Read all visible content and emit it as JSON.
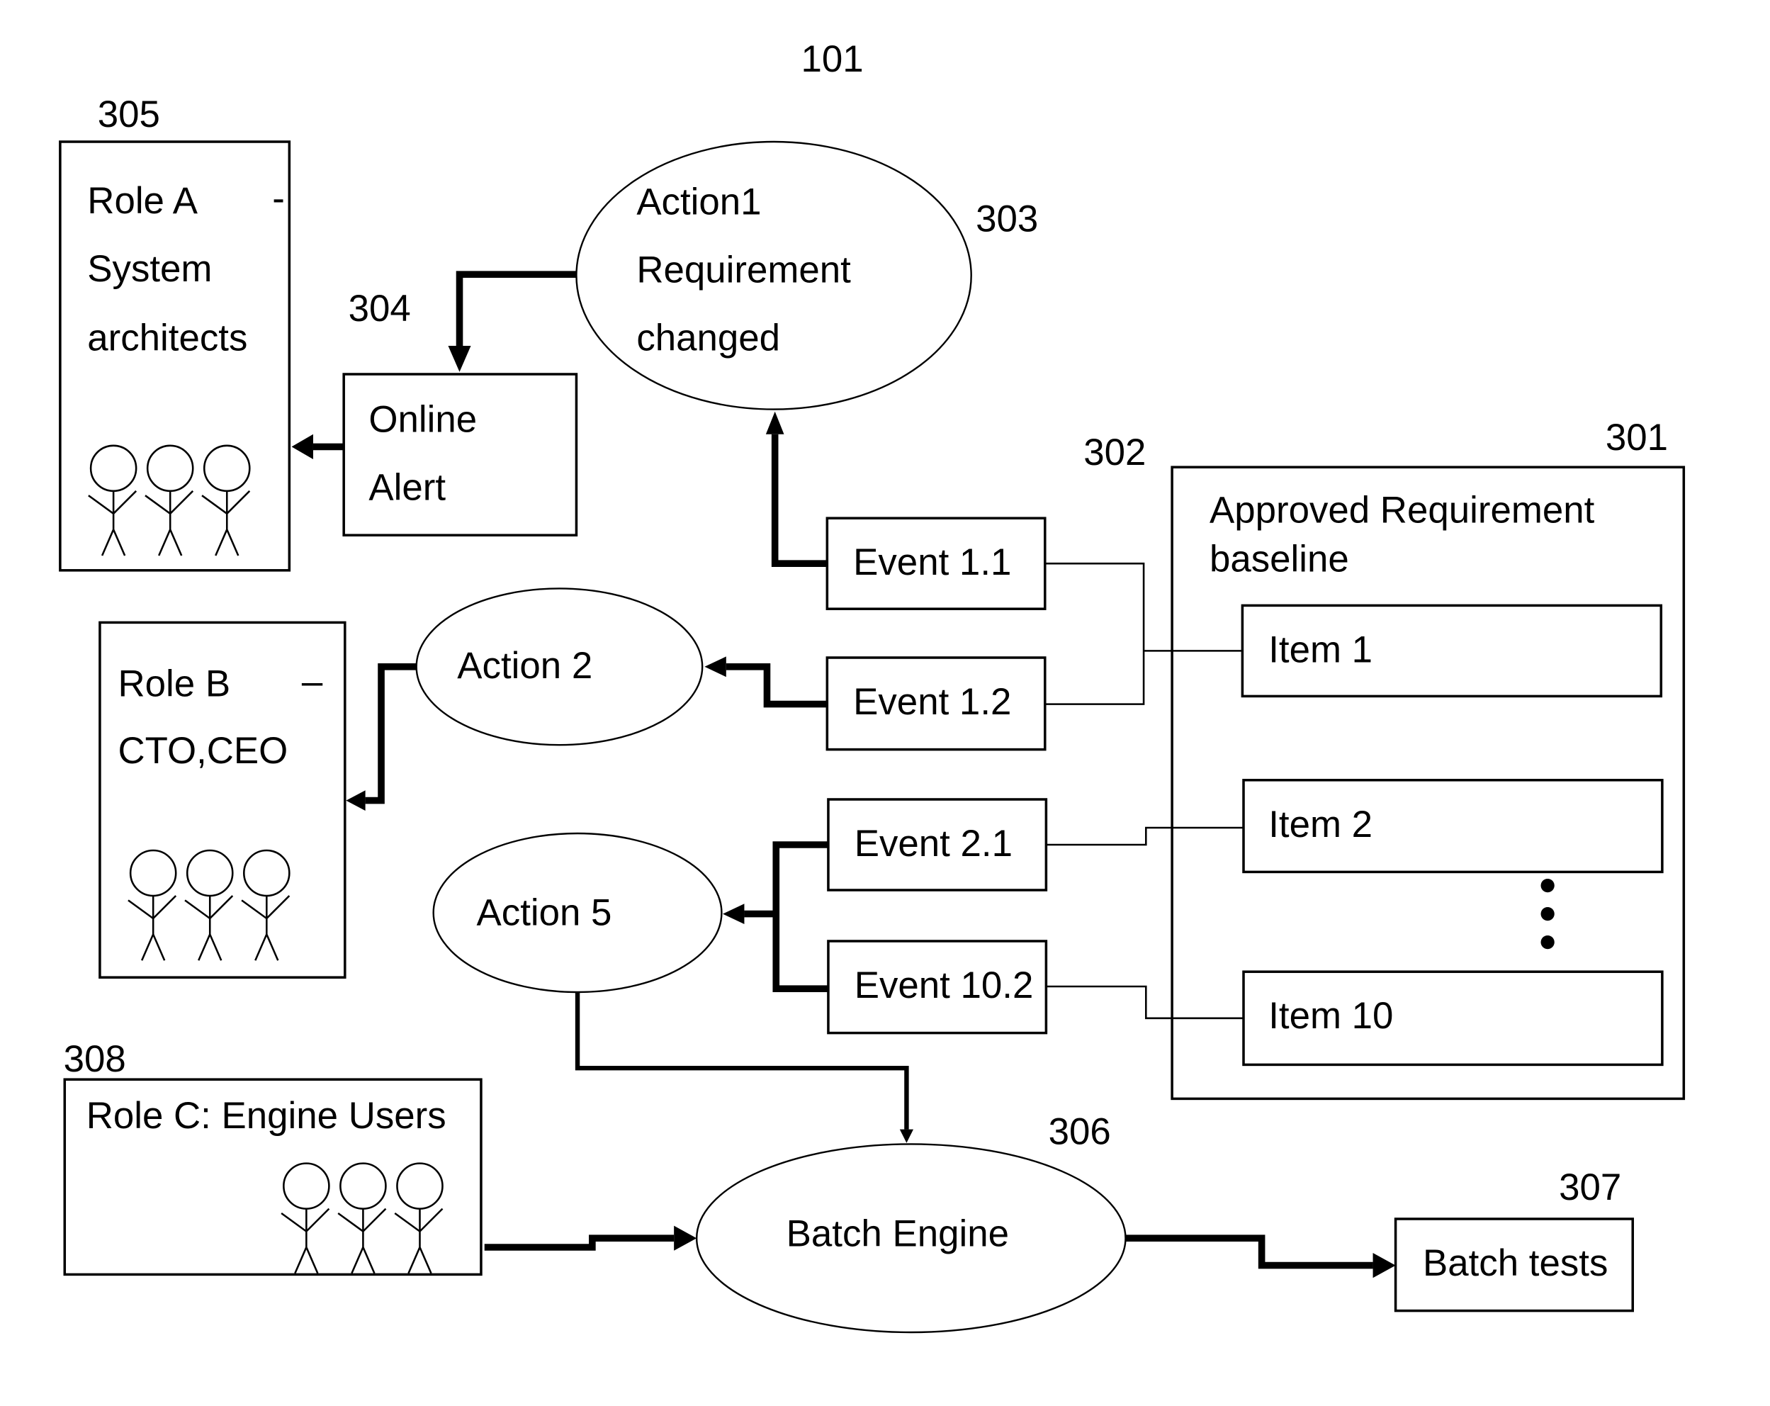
{
  "figure": {
    "reference_numerals": {
      "figure": "101",
      "approved_baseline": "301",
      "events": "302",
      "action1": "303",
      "online_alert": "304",
      "role_a": "305",
      "batch_engine": "306",
      "batch_tests": "307",
      "role_c": "308"
    },
    "role_a": {
      "line1": "Role A",
      "dash": "-",
      "line2": "System",
      "line3": "architects",
      "icon": "stick-figures-icon"
    },
    "role_b": {
      "line1": "Role B",
      "dash": "–",
      "line2": "CTO,CEO",
      "icon": "stick-figures-icon"
    },
    "role_c": {
      "line1": "Role C: Engine Users",
      "icon": "stick-figures-icon"
    },
    "online_alert": {
      "line1": "Online",
      "line2": "Alert"
    },
    "action1": {
      "line1": "Action1",
      "line2": "Requirement",
      "line3": "changed"
    },
    "action2": {
      "label": "Action 2"
    },
    "action5": {
      "label": "Action 5"
    },
    "events": [
      {
        "label": "Event 1.1"
      },
      {
        "label": "Event 1.2"
      },
      {
        "label": "Event 2.1"
      },
      {
        "label": "Event 10.2"
      }
    ],
    "baseline": {
      "title_line1": "Approved Requirement",
      "title_line2": "baseline",
      "items": [
        {
          "label": "Item 1"
        },
        {
          "label": "Item 2"
        },
        {
          "label": "Item 10"
        }
      ],
      "ellipsis_icon": "vertical-ellipsis-icon"
    },
    "batch_engine": {
      "label": "Batch Engine"
    },
    "batch_tests": {
      "label": "Batch tests"
    }
  }
}
